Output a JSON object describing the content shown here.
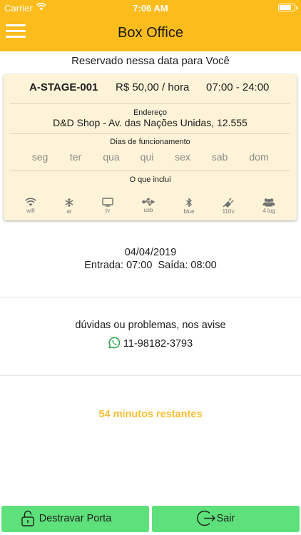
{
  "status_bar": {
    "carrier": "Carrier",
    "time": "7:06 AM",
    "battery_level": 0.8
  },
  "header": {
    "title": "Box Office",
    "menu_icon": "hamburger-menu-icon"
  },
  "reservation": {
    "label": "Reservado nessa data para Você",
    "stage_code": "A-STAGE-001",
    "price": "R$ 50,00 / hora",
    "hours": "07:00 - 24:00",
    "address_label": "Endereço",
    "address": "D&D Shop - Av. das Nações Unidas, 12.555",
    "days_label": "Dias de funcionamento",
    "days": [
      "seg",
      "ter",
      "qua",
      "qui",
      "sex",
      "sab",
      "dom"
    ],
    "includes_label": "O que inclui",
    "amenities": [
      {
        "label": "wifi",
        "icon": "wifi-icon"
      },
      {
        "label": "ar",
        "icon": "snowflake-icon"
      },
      {
        "label": "tv",
        "icon": "tv-icon"
      },
      {
        "label": "usb",
        "icon": "usb-icon"
      },
      {
        "label": "blue",
        "icon": "bluetooth-icon"
      },
      {
        "label": "110v",
        "icon": "power-plug-icon"
      },
      {
        "label": "4 lug",
        "icon": "people-icon"
      }
    ]
  },
  "booking": {
    "date": "04/04/2019",
    "checkin": "Entrada: 07:00",
    "checkout": "Saída: 08:00"
  },
  "contact": {
    "text": "dúvidas ou problemas, nos avise",
    "phone": "11-98182-3793",
    "icon": "whatsapp-icon"
  },
  "remaining": "54 minutos restantes",
  "actions": {
    "unlock_label": "Destravar Porta",
    "exit_label": "Sair"
  },
  "colors": {
    "accent": "#fcbc1c",
    "card_bg": "#fcf3d8",
    "button_green": "#5ee07a",
    "remaining_text": "#f5bf32"
  }
}
